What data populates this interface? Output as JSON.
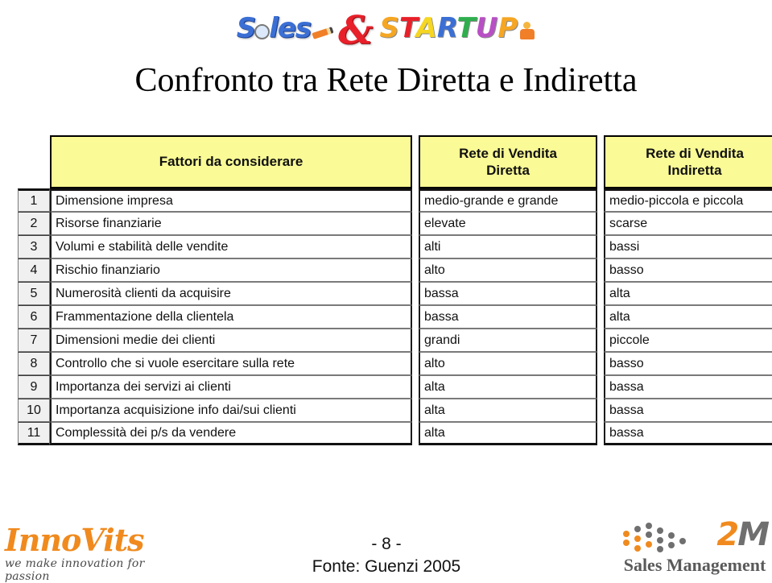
{
  "banner": {
    "word_sales": "Sales",
    "ampersand": "&",
    "word_startup": "STARTUP",
    "startup_letters": [
      "S",
      "T",
      "A",
      "R",
      "T",
      "U",
      "P"
    ]
  },
  "slide": {
    "title": "Confronto tra Rete Diretta e Indiretta",
    "page_number": "- 8 -",
    "source": "Fonte: Guenzi 2005"
  },
  "table": {
    "headers": {
      "number": "",
      "factors": "Fattori da considerare",
      "direct_line1": "Rete di Vendita",
      "direct_line2": "Diretta",
      "indirect_line1": "Rete di Vendita",
      "indirect_line2": "Indiretta"
    },
    "rows": [
      {
        "n": "1",
        "factor": "Dimensione impresa",
        "diretta": "medio-grande e grande",
        "indiretta": "medio-piccola e piccola"
      },
      {
        "n": "2",
        "factor": "Risorse finanziarie",
        "diretta": "elevate",
        "indiretta": "scarse"
      },
      {
        "n": "3",
        "factor": "Volumi e stabilità delle vendite",
        "diretta": "alti",
        "indiretta": "bassi"
      },
      {
        "n": "4",
        "factor": "Rischio finanziario",
        "diretta": "alto",
        "indiretta": "basso"
      },
      {
        "n": "5",
        "factor": "Numerosità clienti da acquisire",
        "diretta": "bassa",
        "indiretta": "alta"
      },
      {
        "n": "6",
        "factor": "Frammentazione della clientela",
        "diretta": "bassa",
        "indiretta": "alta"
      },
      {
        "n": "7",
        "factor": "Dimensioni medie dei clienti",
        "diretta": "grandi",
        "indiretta": "piccole"
      },
      {
        "n": "8",
        "factor": "Controllo che si vuole esercitare sulla rete",
        "diretta": "alto",
        "indiretta": "basso"
      },
      {
        "n": "9",
        "factor": "Importanza dei servizi ai clienti",
        "diretta": "alta",
        "indiretta": "bassa"
      },
      {
        "n": "10",
        "factor": "Importanza acquisizione info dai/sui clienti",
        "diretta": "alta",
        "indiretta": "bassa"
      },
      {
        "n": "11",
        "factor": "Complessità dei p/s da vendere",
        "diretta": "alta",
        "indiretta": "bassa"
      }
    ]
  },
  "footer": {
    "innovits_name": "InnoVits",
    "innovits_tagline": "we make innovation for passion",
    "twom_number": "2",
    "twom_letter": "M",
    "twom_label": "Sales Management"
  },
  "colors": {
    "header_yellow": "#fafa96",
    "number_col_gray": "#f0f0f0",
    "orange": "#f08a1e",
    "gray": "#6f6f6f",
    "border": "#1a1a1a"
  }
}
